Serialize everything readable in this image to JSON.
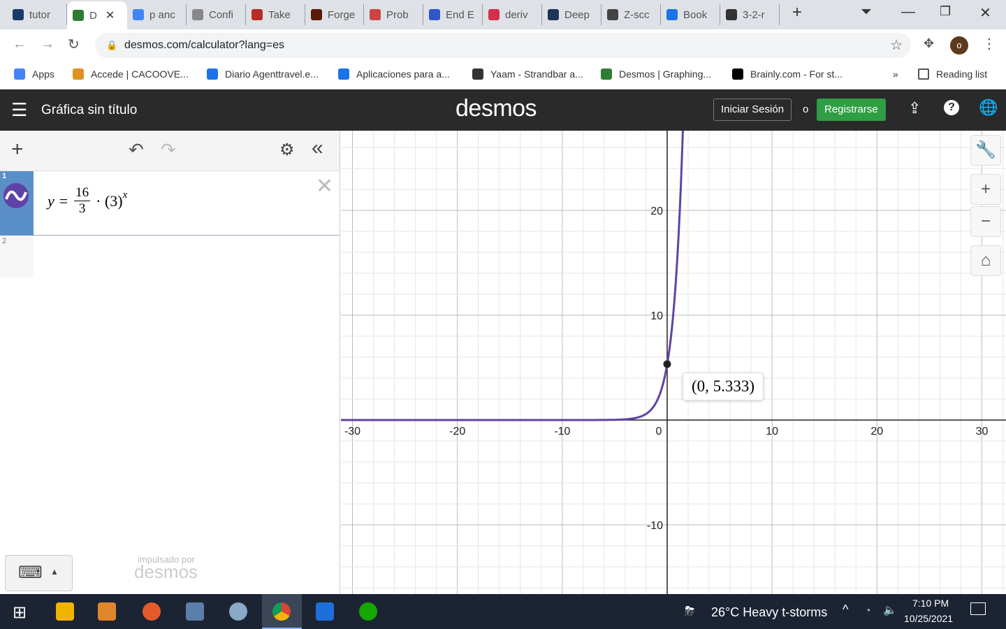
{
  "browser": {
    "tabs": [
      {
        "label": "tutor",
        "color": "#1a3a6b"
      },
      {
        "label": "D",
        "color": "#2e7d32",
        "active": true
      },
      {
        "label": "p anc",
        "color": "#4285f4"
      },
      {
        "label": "Confi",
        "color": "#888"
      },
      {
        "label": "Take",
        "color": "#b92b27"
      },
      {
        "label": "Forge",
        "color": "#5a1a0a"
      },
      {
        "label": "Prob",
        "color": "#c44"
      },
      {
        "label": "End E",
        "color": "#3355cc"
      },
      {
        "label": "deriv",
        "color": "#d32f4a"
      },
      {
        "label": "Deep",
        "color": "#1d3557"
      },
      {
        "label": "Z-scc",
        "color": "#444"
      },
      {
        "label": "Book",
        "color": "#1a73e8"
      },
      {
        "label": "3-2-r",
        "color": "#333"
      }
    ],
    "url": "desmos.com/calculator?lang=es",
    "profile_initial": "o",
    "bookmarks": [
      "Apps",
      "Accede | CACOOVE...",
      "Diario Agenttravel.e...",
      "Aplicaciones para a...",
      "Yaam - Strandbar a...",
      "Desmos | Graphing...",
      "Brainly.com - For st..."
    ],
    "bookmarks_more": "»",
    "reading_list": "Reading list"
  },
  "desmos": {
    "title": "Gráfica sin título",
    "logo": "desmos",
    "signin": "Iniciar Sesión",
    "or": "o",
    "register": "Registrarse",
    "expressions": [
      {
        "index": "1",
        "lhs": "y =",
        "num": "16",
        "den": "3",
        "rest": "· (3)",
        "exp": "x",
        "color": "#6042a6"
      },
      {
        "index": "2"
      }
    ],
    "powered_by": "impulsado por",
    "powered_logo": "desmos",
    "point_label": "(0, 5.333)"
  },
  "chart_data": {
    "type": "line",
    "function": "y = 16/3 · 3^x",
    "xlim": [
      -31.1,
      32.3
    ],
    "ylim": [
      -16.6,
      27.6
    ],
    "grid": true,
    "x_ticks": [
      -30,
      -20,
      -10,
      0,
      10,
      20,
      30
    ],
    "y_ticks": [
      20,
      10,
      -10
    ],
    "highlighted_point": {
      "x": 0,
      "y": 5.333
    },
    "color": "#6042a6"
  },
  "taskbar": {
    "weather": "26°C  Heavy t-storms",
    "time": "7:10 PM",
    "date": "10/25/2021"
  }
}
